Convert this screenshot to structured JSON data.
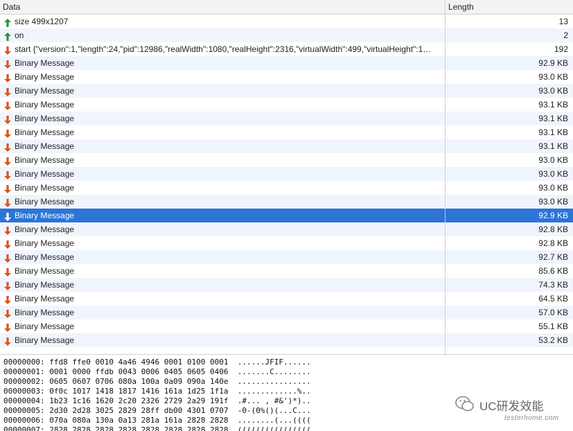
{
  "columns": {
    "data": "Data",
    "length": "Length"
  },
  "colors": {
    "up": "#2f8f3a",
    "down": "#d9541e",
    "selected": "#2c74d6"
  },
  "messages": [
    {
      "dir": "up",
      "icon": "up-arrow-icon",
      "text": "size 499x1207",
      "length": "13"
    },
    {
      "dir": "up",
      "icon": "up-arrow-icon",
      "text": "on",
      "length": "2"
    },
    {
      "dir": "down",
      "icon": "down-arrow-icon",
      "text": "start {\"version\":1,\"length\":24,\"pid\":12986,\"realWidth\":1080,\"realHeight\":2316,\"virtualWidth\":499,\"virtualHeight\":1…",
      "length": "192"
    },
    {
      "dir": "down",
      "icon": "down-arrow-icon",
      "text": "Binary Message",
      "length": "92.9 KB"
    },
    {
      "dir": "down",
      "icon": "down-arrow-icon",
      "text": "Binary Message",
      "length": "93.0 KB"
    },
    {
      "dir": "down",
      "icon": "down-arrow-icon",
      "text": "Binary Message",
      "length": "93.0 KB"
    },
    {
      "dir": "down",
      "icon": "down-arrow-icon",
      "text": "Binary Message",
      "length": "93.1 KB"
    },
    {
      "dir": "down",
      "icon": "down-arrow-icon",
      "text": "Binary Message",
      "length": "93.1 KB"
    },
    {
      "dir": "down",
      "icon": "down-arrow-icon",
      "text": "Binary Message",
      "length": "93.1 KB"
    },
    {
      "dir": "down",
      "icon": "down-arrow-icon",
      "text": "Binary Message",
      "length": "93.1 KB"
    },
    {
      "dir": "down",
      "icon": "down-arrow-icon",
      "text": "Binary Message",
      "length": "93.0 KB"
    },
    {
      "dir": "down",
      "icon": "down-arrow-icon",
      "text": "Binary Message",
      "length": "93.0 KB"
    },
    {
      "dir": "down",
      "icon": "down-arrow-icon",
      "text": "Binary Message",
      "length": "93.0 KB"
    },
    {
      "dir": "down",
      "icon": "down-arrow-icon",
      "text": "Binary Message",
      "length": "93.0 KB"
    },
    {
      "dir": "down",
      "icon": "down-arrow-icon",
      "text": "Binary Message",
      "length": "92.9 KB",
      "selected": true
    },
    {
      "dir": "down",
      "icon": "down-arrow-icon",
      "text": "Binary Message",
      "length": "92.8 KB"
    },
    {
      "dir": "down",
      "icon": "down-arrow-icon",
      "text": "Binary Message",
      "length": "92.8 KB"
    },
    {
      "dir": "down",
      "icon": "down-arrow-icon",
      "text": "Binary Message",
      "length": "92.7 KB"
    },
    {
      "dir": "down",
      "icon": "down-arrow-icon",
      "text": "Binary Message",
      "length": "85.6 KB"
    },
    {
      "dir": "down",
      "icon": "down-arrow-icon",
      "text": "Binary Message",
      "length": "74.3 KB"
    },
    {
      "dir": "down",
      "icon": "down-arrow-icon",
      "text": "Binary Message",
      "length": "64.5 KB"
    },
    {
      "dir": "down",
      "icon": "down-arrow-icon",
      "text": "Binary Message",
      "length": "57.0 KB"
    },
    {
      "dir": "down",
      "icon": "down-arrow-icon",
      "text": "Binary Message",
      "length": "55.1 KB"
    },
    {
      "dir": "down",
      "icon": "down-arrow-icon",
      "text": "Binary Message",
      "length": "53.2 KB"
    }
  ],
  "hexdump": [
    "00000000: ffd8 ffe0 0010 4a46 4946 0001 0100 0001  ......JFIF......",
    "00000001: 0001 0000 ffdb 0043 0006 0405 0605 0406  .......C........",
    "00000002: 0605 0607 0706 080a 100a 0a09 090a 140e  ................",
    "00000003: 0f0c 1017 1418 1817 1416 161a 1d25 1f1a  .............%..",
    "00000004: 1b23 1c16 1620 2c20 2326 2729 2a29 191f  .#... , #&')*)..",
    "00000005: 2d30 2d28 3025 2829 28ff db00 4301 0707  -0-(0%()(...C...",
    "00000006: 070a 080a 130a 0a13 281a 161a 2828 2828  ........(...((((",
    "00000007: 2828 2828 2828 2828 2828 2828 2828 2828  (((((((((((((((("
  ],
  "watermark": {
    "brand": "UC研发效能",
    "sub": "testerhome.com",
    "icon": "wechat-icon"
  }
}
